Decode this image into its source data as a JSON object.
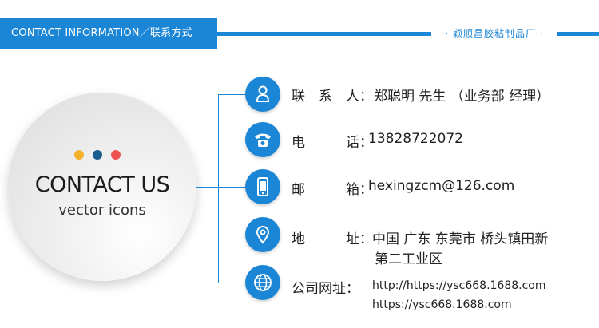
{
  "header": {
    "tab_text": "CONTACT INFORMATION／联系方式",
    "brand_text": "· 颖顺昌胶粘制品厂 ·"
  },
  "colors": {
    "accent": "#1c86d6",
    "dot_yellow": "#f5b12b",
    "dot_blue": "#1a5d8f",
    "dot_red": "#ee5350"
  },
  "circle": {
    "title": "CONTACT US",
    "subtitle": "vector icons"
  },
  "contacts": [
    {
      "icon": "person-icon",
      "label": "联　系　人：",
      "value": "郑聪明 先生 （业务部 经理）"
    },
    {
      "icon": "phone-icon",
      "label": "电　　　话：",
      "value": "13828722072"
    },
    {
      "icon": "mobile-icon",
      "label": "邮　　　箱：",
      "value": "hexingzcm@126.com"
    },
    {
      "icon": "location-icon",
      "label": "地　　　址：",
      "value": "中国 广东 东莞市 桥头镇田新",
      "value2": "第二工业区"
    },
    {
      "icon": "globe-icon",
      "label": "公司网址：",
      "value": "http://https://ysc668.1688.com",
      "value2": "https://ysc668.1688.com"
    }
  ]
}
